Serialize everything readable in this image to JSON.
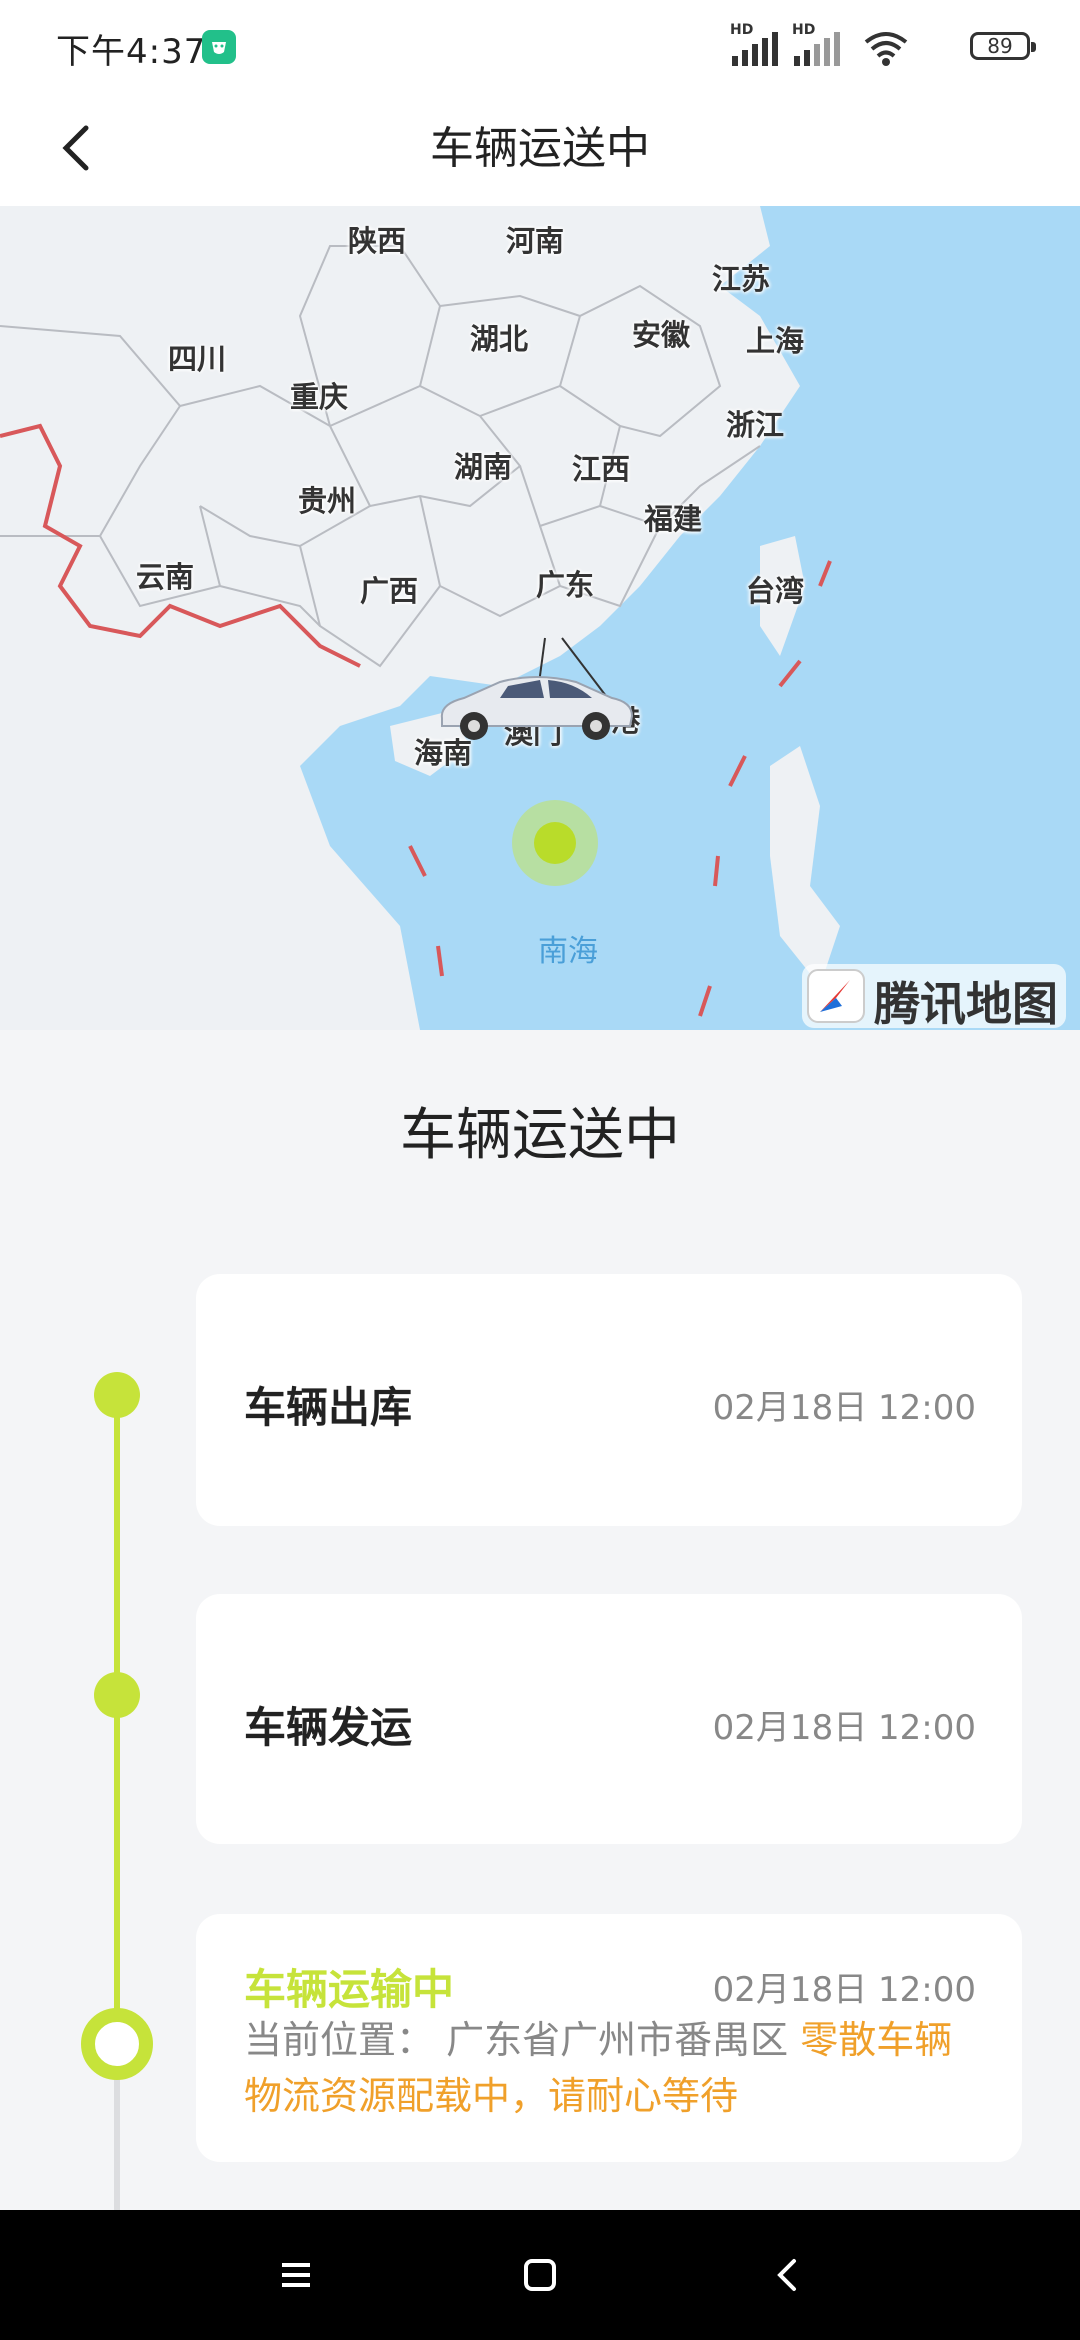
{
  "status_bar": {
    "time": "下午4:37",
    "signal_1": "HD",
    "signal_2": "HD",
    "battery": "89"
  },
  "header": {
    "title": "车辆运送中",
    "back_icon": "chevron-left-icon"
  },
  "map": {
    "provinces": [
      "陕西",
      "河南",
      "江苏",
      "四川",
      "湖北",
      "安徽",
      "上海",
      "重庆",
      "浙江",
      "湖南",
      "江西",
      "贵州",
      "福建",
      "云南",
      "广西",
      "广东",
      "台湾",
      "澳门",
      "香港",
      "海南"
    ],
    "sea": "南海",
    "logo_text": "腾讯地图"
  },
  "main": {
    "title": "车辆运送中",
    "steps": [
      {
        "title": "车辆出库",
        "time": "02月18日 12:00"
      },
      {
        "title": "车辆发运",
        "time": "02月18日 12:00"
      },
      {
        "title": "车辆运输中",
        "time": "02月18日 12:00",
        "location_label": "当前位置：",
        "location": "广东省广州市番禺区",
        "note": "零散车辆物流资源配载中，请耐心等待"
      }
    ]
  },
  "colors": {
    "accent": "#c6e33a",
    "note": "#f0a02a",
    "map_water": "#a9d9f6"
  },
  "nav_bar": {
    "menu_icon": "menu-icon",
    "home_icon": "home-square-icon",
    "back_icon": "back-triangle-icon"
  }
}
